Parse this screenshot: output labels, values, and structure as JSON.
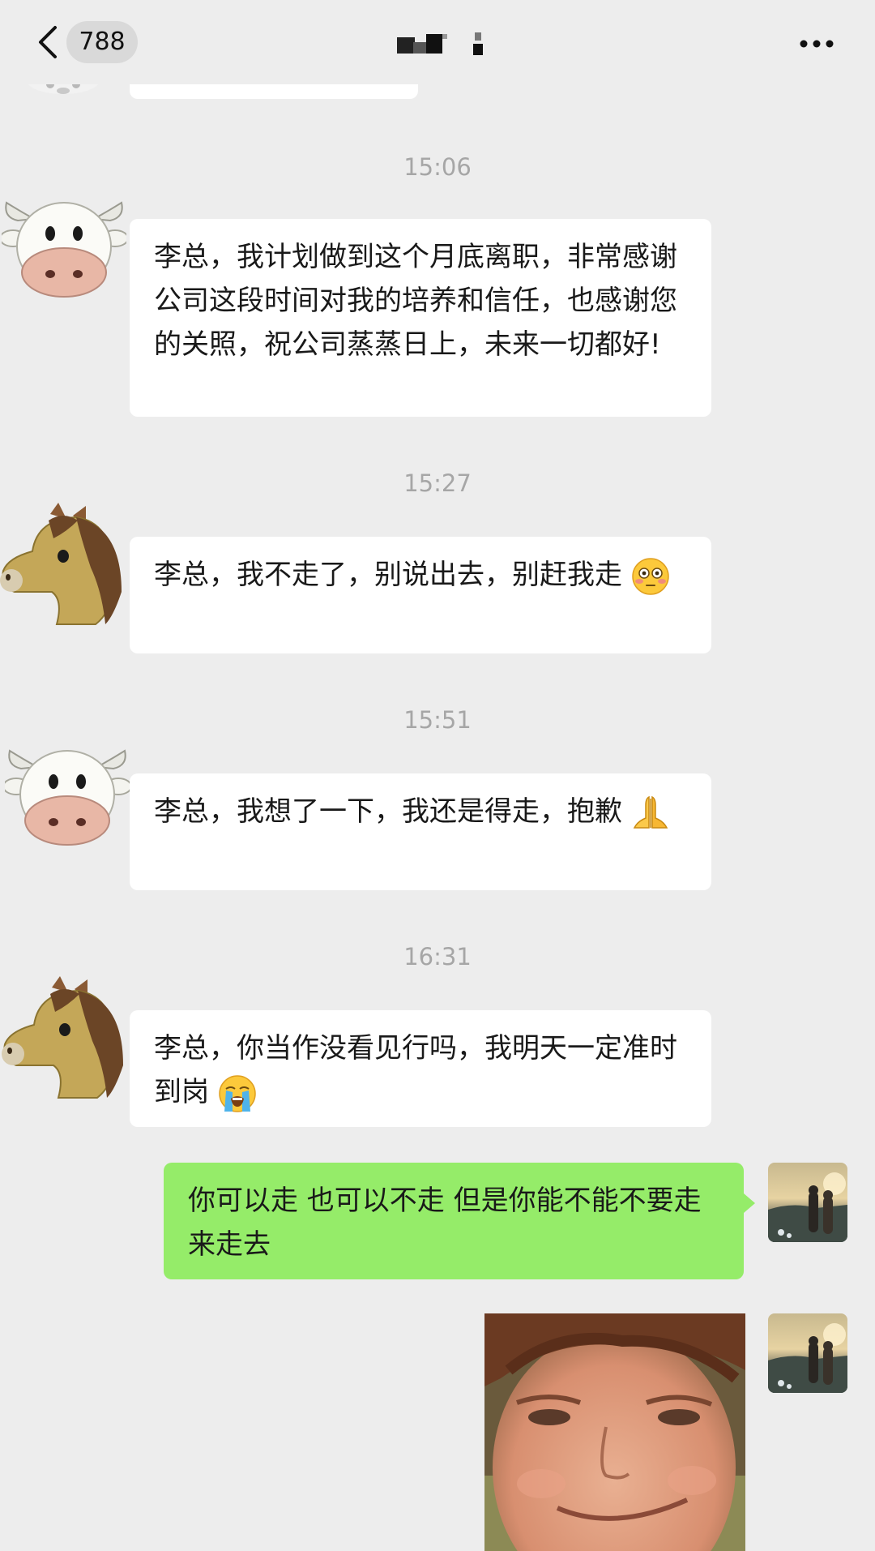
{
  "header": {
    "unread_count": "788",
    "title": ""
  },
  "messages": [
    {
      "time": "15:06",
      "sender": "cow",
      "text": "李总，我计划做到这个月底离职，非常感谢公司这段时间对我的培养和信任，也感谢您的关照，祝公司蒸蒸日上，未来一切都好!"
    },
    {
      "time": "15:27",
      "sender": "horse",
      "text": "李总，我不走了，别说出去，别赶我走",
      "emoji": "flushed-face-icon"
    },
    {
      "time": "15:51",
      "sender": "cow",
      "text": "李总，我想了一下，我还是得走，抱歉",
      "emoji": "folded-hands-icon"
    },
    {
      "time": "16:31",
      "sender": "horse",
      "text": "李总，你当作没看见行吗，我明天一定准时到岗",
      "emoji": "loudly-crying-face-icon"
    },
    {
      "sender": "me",
      "text": "你可以走  也可以不走  但是你能不能不要走来走去"
    },
    {
      "sender": "me",
      "image": "smirking-kid-meme"
    }
  ],
  "colors": {
    "background": "#ededed",
    "received_bubble": "#ffffff",
    "sent_bubble": "#95ec69",
    "timestamp": "#a6a6a6"
  }
}
